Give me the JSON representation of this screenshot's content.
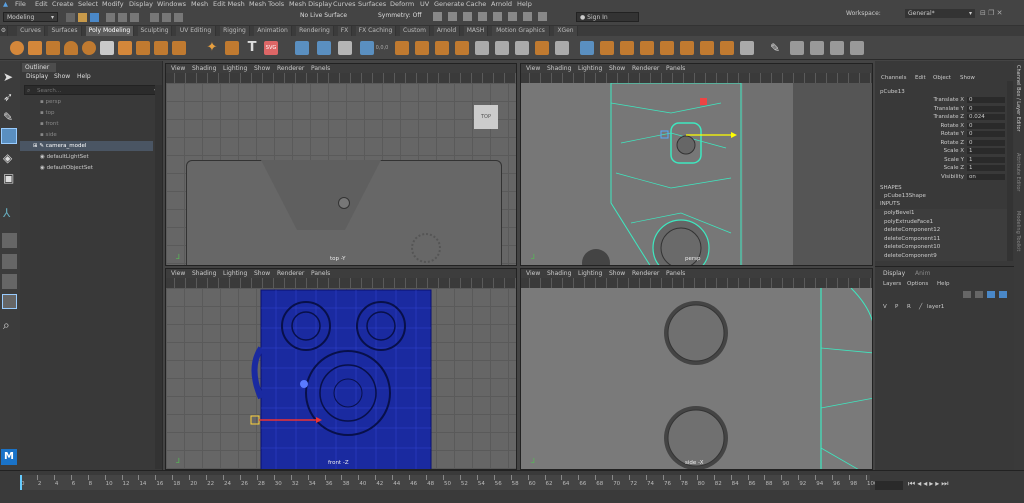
{
  "menus": [
    "File",
    "Edit",
    "Create",
    "Select",
    "Modify",
    "Display",
    "Windows",
    "Mesh",
    "Edit Mesh",
    "Mesh Tools",
    "Mesh Display",
    "Curves",
    "Surfaces",
    "Deform",
    "UV",
    "Generate",
    "Cache",
    "Arnold",
    "Help"
  ],
  "workspace_label": "Workspace:",
  "workspace_value": "General*",
  "status": {
    "mode": "Modeling",
    "live_surface": "No Live Surface",
    "symmetry": "Symmetry: Off",
    "sign_in": "Sign In"
  },
  "shelf_tabs": [
    "Curves",
    "Surfaces",
    "Poly Modeling",
    "Sculpting",
    "UV Editing",
    "Rigging",
    "Animation",
    "Rendering",
    "FX",
    "FX Caching",
    "Custom",
    "Arnold",
    "MASH",
    "Motion Graphics",
    "XGen"
  ],
  "active_shelf_tab": "Poly Modeling",
  "shelf_text_icon": "T",
  "outliner": {
    "title": "Outliner",
    "menu": [
      "Display",
      "Show",
      "Help"
    ],
    "search_placeholder": "Search...",
    "items": [
      "persp",
      "top",
      "front",
      "side",
      "camera_model",
      "defaultLightSet",
      "defaultObjectSet"
    ]
  },
  "viewport_menu": [
    "View",
    "Shading",
    "Lighting",
    "Show",
    "Renderer",
    "Panels"
  ],
  "viewports": {
    "top": {
      "label": "top -Y",
      "cube_label": "TOP"
    },
    "persp": {
      "label": "persp"
    },
    "front": {
      "label": "front -Z"
    },
    "side": {
      "label": "side -X"
    }
  },
  "channel_box": {
    "menu": [
      "Channels",
      "Edit",
      "Object",
      "Show"
    ],
    "object": "pCube13",
    "attributes": [
      {
        "name": "Translate X",
        "value": "0"
      },
      {
        "name": "Translate Y",
        "value": "0"
      },
      {
        "name": "Translate Z",
        "value": "0.024"
      },
      {
        "name": "Rotate X",
        "value": "0"
      },
      {
        "name": "Rotate Y",
        "value": "0"
      },
      {
        "name": "Rotate Z",
        "value": "0"
      },
      {
        "name": "Scale X",
        "value": "1"
      },
      {
        "name": "Scale Y",
        "value": "1"
      },
      {
        "name": "Scale Z",
        "value": "1"
      },
      {
        "name": "Visibility",
        "value": "on"
      }
    ],
    "shapes_header": "SHAPES",
    "shape": "pCube13Shape",
    "inputs_header": "INPUTS",
    "inputs": [
      "polyBevel1",
      "polyExtrudeFace1",
      "deleteComponent12",
      "deleteComponent11",
      "deleteComponent10",
      "deleteComponent9"
    ]
  },
  "layer_editor": {
    "tabs": [
      "Display",
      "Anim"
    ],
    "menu": [
      "Layers",
      "Options",
      "Help"
    ],
    "layer": {
      "v": "V",
      "p": "P",
      "r": "R",
      "name": "layer1"
    }
  },
  "side_tabs": [
    "Channel Box / Layer Editor",
    "Attribute Editor",
    "Modeling Toolkit"
  ],
  "mel_label": "M",
  "timeline": {
    "ticks": [
      "0",
      "2",
      "4",
      "6",
      "8",
      "10",
      "12",
      "14",
      "16",
      "18",
      "20",
      "22",
      "24",
      "26",
      "28",
      "30",
      "32",
      "34",
      "36",
      "38",
      "40",
      "42",
      "44",
      "46",
      "48",
      "50",
      "52",
      "54",
      "56",
      "58",
      "60",
      "62",
      "64",
      "66",
      "68",
      "70",
      "72",
      "74",
      "76",
      "78",
      "80",
      "82",
      "84",
      "86",
      "88",
      "90",
      "92",
      "94",
      "96",
      "98",
      "100"
    ]
  }
}
